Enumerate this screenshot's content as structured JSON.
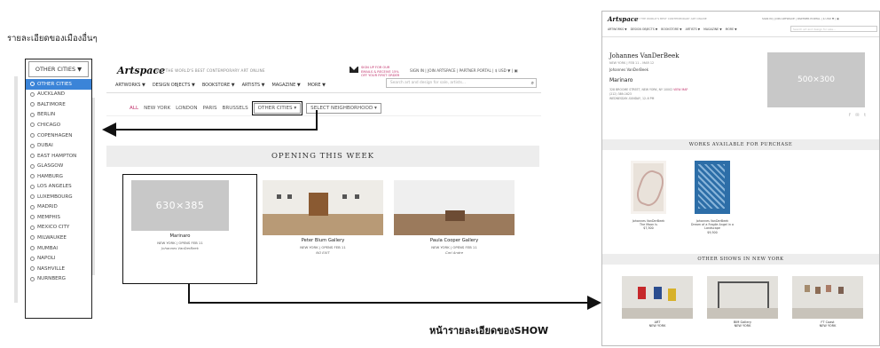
{
  "captions": {
    "top": "รายละเอียดของเมืองอื่นๆ",
    "bottom": "หน้ารายละเอียดของSHOW"
  },
  "dropdown": {
    "label": "OTHER CITIES ▼",
    "items": [
      "OTHER CITIES",
      "AUCKLAND",
      "BALTIMORE",
      "BERLIN",
      "CHICAGO",
      "COPENHAGEN",
      "DUBAI",
      "EAST HAMPTON",
      "GLASGOW",
      "HAMBURG",
      "LOS ANGELES",
      "LUXEMBOURG",
      "MADRID",
      "MEMPHIS",
      "MEXICO CITY",
      "MILWAUKEE",
      "MUMBAI",
      "NAPOLI",
      "NASHVILLE",
      "NURNBERG"
    ],
    "selected_index": 0
  },
  "mid": {
    "logo": "Artspace",
    "tagline": "BUY THE WORLD'S BEST CONTEMPORARY ART ONLINE",
    "signup": "SIGN UP FOR OUR EMAILS & RECEIVE 15% OFF YOUR FIRST ORDER",
    "toplinks": "SIGN IN | JOIN ARTSPACE | PARTNER PORTAL | $ USD ▼ | ▣",
    "nav": [
      "ARTWORKS ▼",
      "DESIGN OBJECTS ▼",
      "BOOKSTORE ▼",
      "ARTISTS ▼",
      "MAGAZINE ▼",
      "MORE ▼"
    ],
    "search_placeholder": "Search art and design for sale, artists…",
    "filters": [
      "ALL",
      "NEW YORK",
      "LONDON",
      "PARIS",
      "BRUSSELS"
    ],
    "filter_other": "OTHER CITIES ▾",
    "filter_select": "SELECT NEIGHBORHOOD ▾",
    "opening": "OPENING THIS WEEK",
    "cards": [
      {
        "image": "630×385",
        "title": "Marinaro",
        "meta": "NEW YORK | OPENS FEB 11",
        "artist": "Johannes VanDerBeek"
      },
      {
        "title": "Peter Blum Gallery",
        "meta": "NEW YORK | OPENS FEB 11",
        "artist": "NO EXIT"
      },
      {
        "title": "Paula Cooper Gallery",
        "meta": "NEW YORK | OPENS FEB 11",
        "artist": "Carl Andre"
      }
    ]
  },
  "right": {
    "logo": "Artspace",
    "tagline": "BUY THE WORLD'S BEST CONTEMPORARY ART ONLINE",
    "toplinks": "SIGN IN | JOIN ARTSPACE | PARTNER PORTAL | $ USD ▼ | ▣",
    "nav": [
      "ARTWORKS ▼",
      "DESIGN OBJECTS ▼",
      "BOOKSTORE ▼",
      "ARTISTS ▼",
      "MAGAZINE ▼",
      "MORE ▼"
    ],
    "search_placeholder": "Search art and design for sale…",
    "artist": "Johannes VanDerBeek",
    "sub": "NEW YORK | FEB 11 – MAR 12",
    "artist2": "Johannes VanDerBeek",
    "show": "Marinaro",
    "info": "328 BROOME STREET, NEW YORK, NY 10002",
    "map": "VIEW MAP",
    "phone": "(212) 389-1623",
    "hours": "WEDNESDAY–SUNDAY, 12–6 PM",
    "hero": "500×300",
    "share": "f ✉ t",
    "bar1": "WORKS AVAILABLE FOR PURCHASE",
    "works": [
      {
        "artist": "Johannes VanDerBeek",
        "title": "The Moon Is",
        "price": "$7,500"
      },
      {
        "artist": "Johannes VanDerBeek",
        "title": "Dream of a Fragile Angel in a Landscape",
        "price": "$9,500"
      }
    ],
    "bar2": "OTHER SHOWS IN NEW YORK",
    "others": [
      {
        "title": "ART",
        "meta": "NEW YORK"
      },
      {
        "title": "BIM Gallery",
        "meta": "NEW YORK"
      },
      {
        "title": "FT Coast",
        "meta": "NEW YORK"
      }
    ]
  }
}
